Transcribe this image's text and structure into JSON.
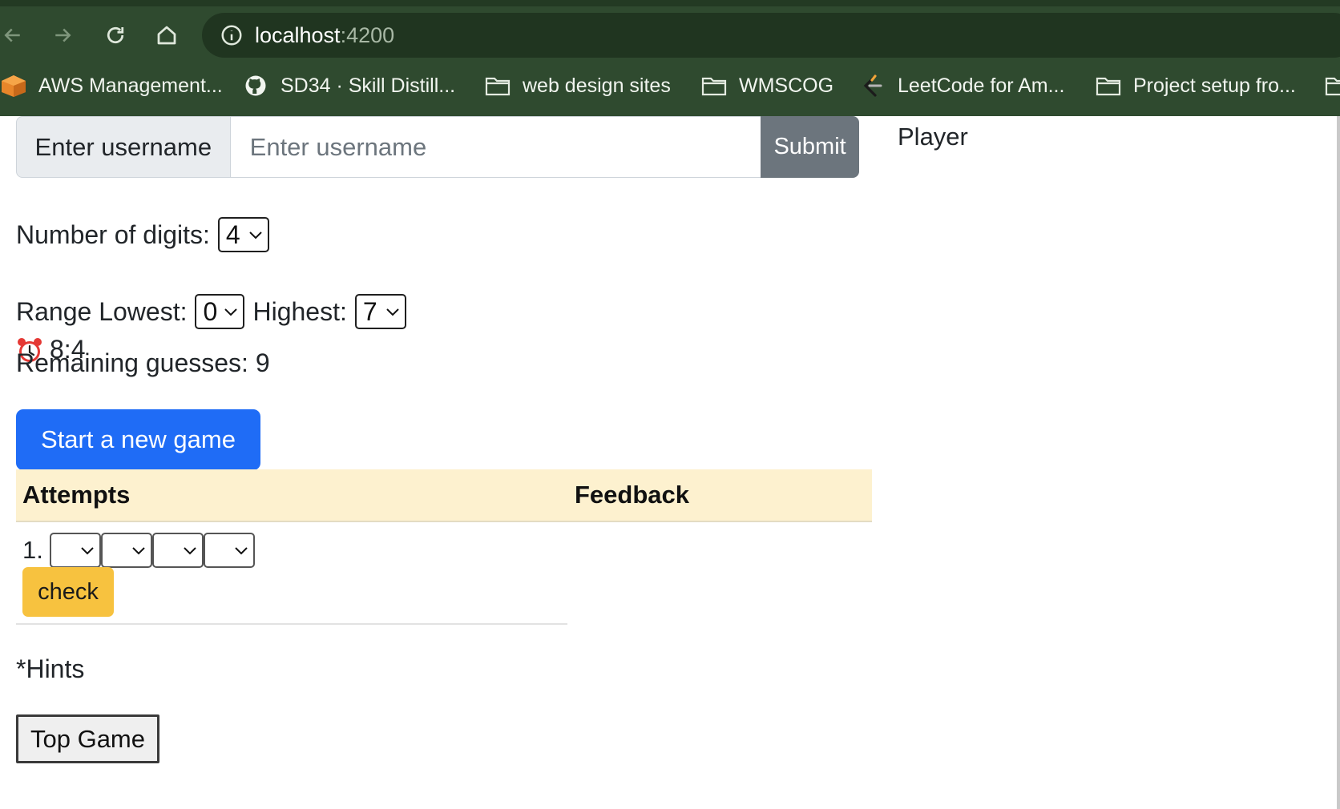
{
  "browser": {
    "url_host": "localhost",
    "url_port": ":4200",
    "bookmarks": [
      {
        "label": "AWS Management...",
        "icon": "aws-cube-icon"
      },
      {
        "label": "SD34 · Skill Distill...",
        "icon": "github-icon"
      },
      {
        "label": "web design sites",
        "icon": "folder-icon"
      },
      {
        "label": "WMSCOG",
        "icon": "folder-icon"
      },
      {
        "label": "LeetCode for Am...",
        "icon": "leetcode-icon"
      },
      {
        "label": "Project setup fro...",
        "icon": "folder-icon"
      }
    ]
  },
  "login": {
    "label": "Enter username",
    "placeholder": "Enter username",
    "value": "",
    "submit_label": "Submit"
  },
  "player": {
    "label": "Player"
  },
  "settings": {
    "digits_label": "Number of digits:",
    "digits_value": "4",
    "range_lowest_label": "Range Lowest:",
    "range_lowest_value": "0",
    "range_highest_label": "Highest:",
    "range_highest_value": "7"
  },
  "timer": {
    "icon": "alarm-clock-icon",
    "value": "8:4"
  },
  "remaining": {
    "text": "Remaining guesses: 9"
  },
  "actions": {
    "new_game_label": "Start a new game",
    "check_label": "check",
    "top_game_label": "Top Game"
  },
  "table": {
    "headers": [
      "Attempts",
      "Feedback"
    ],
    "rows": [
      {
        "number": "1.",
        "digits": [
          "",
          "",
          "",
          ""
        ]
      }
    ]
  },
  "hints": {
    "text": "*Hints"
  },
  "colors": {
    "chrome": "#2f4a2f",
    "primary": "#1f6cf6",
    "secondary": "#6c757d",
    "warning": "#f7c23f",
    "table_head": "#fdf1cf"
  }
}
